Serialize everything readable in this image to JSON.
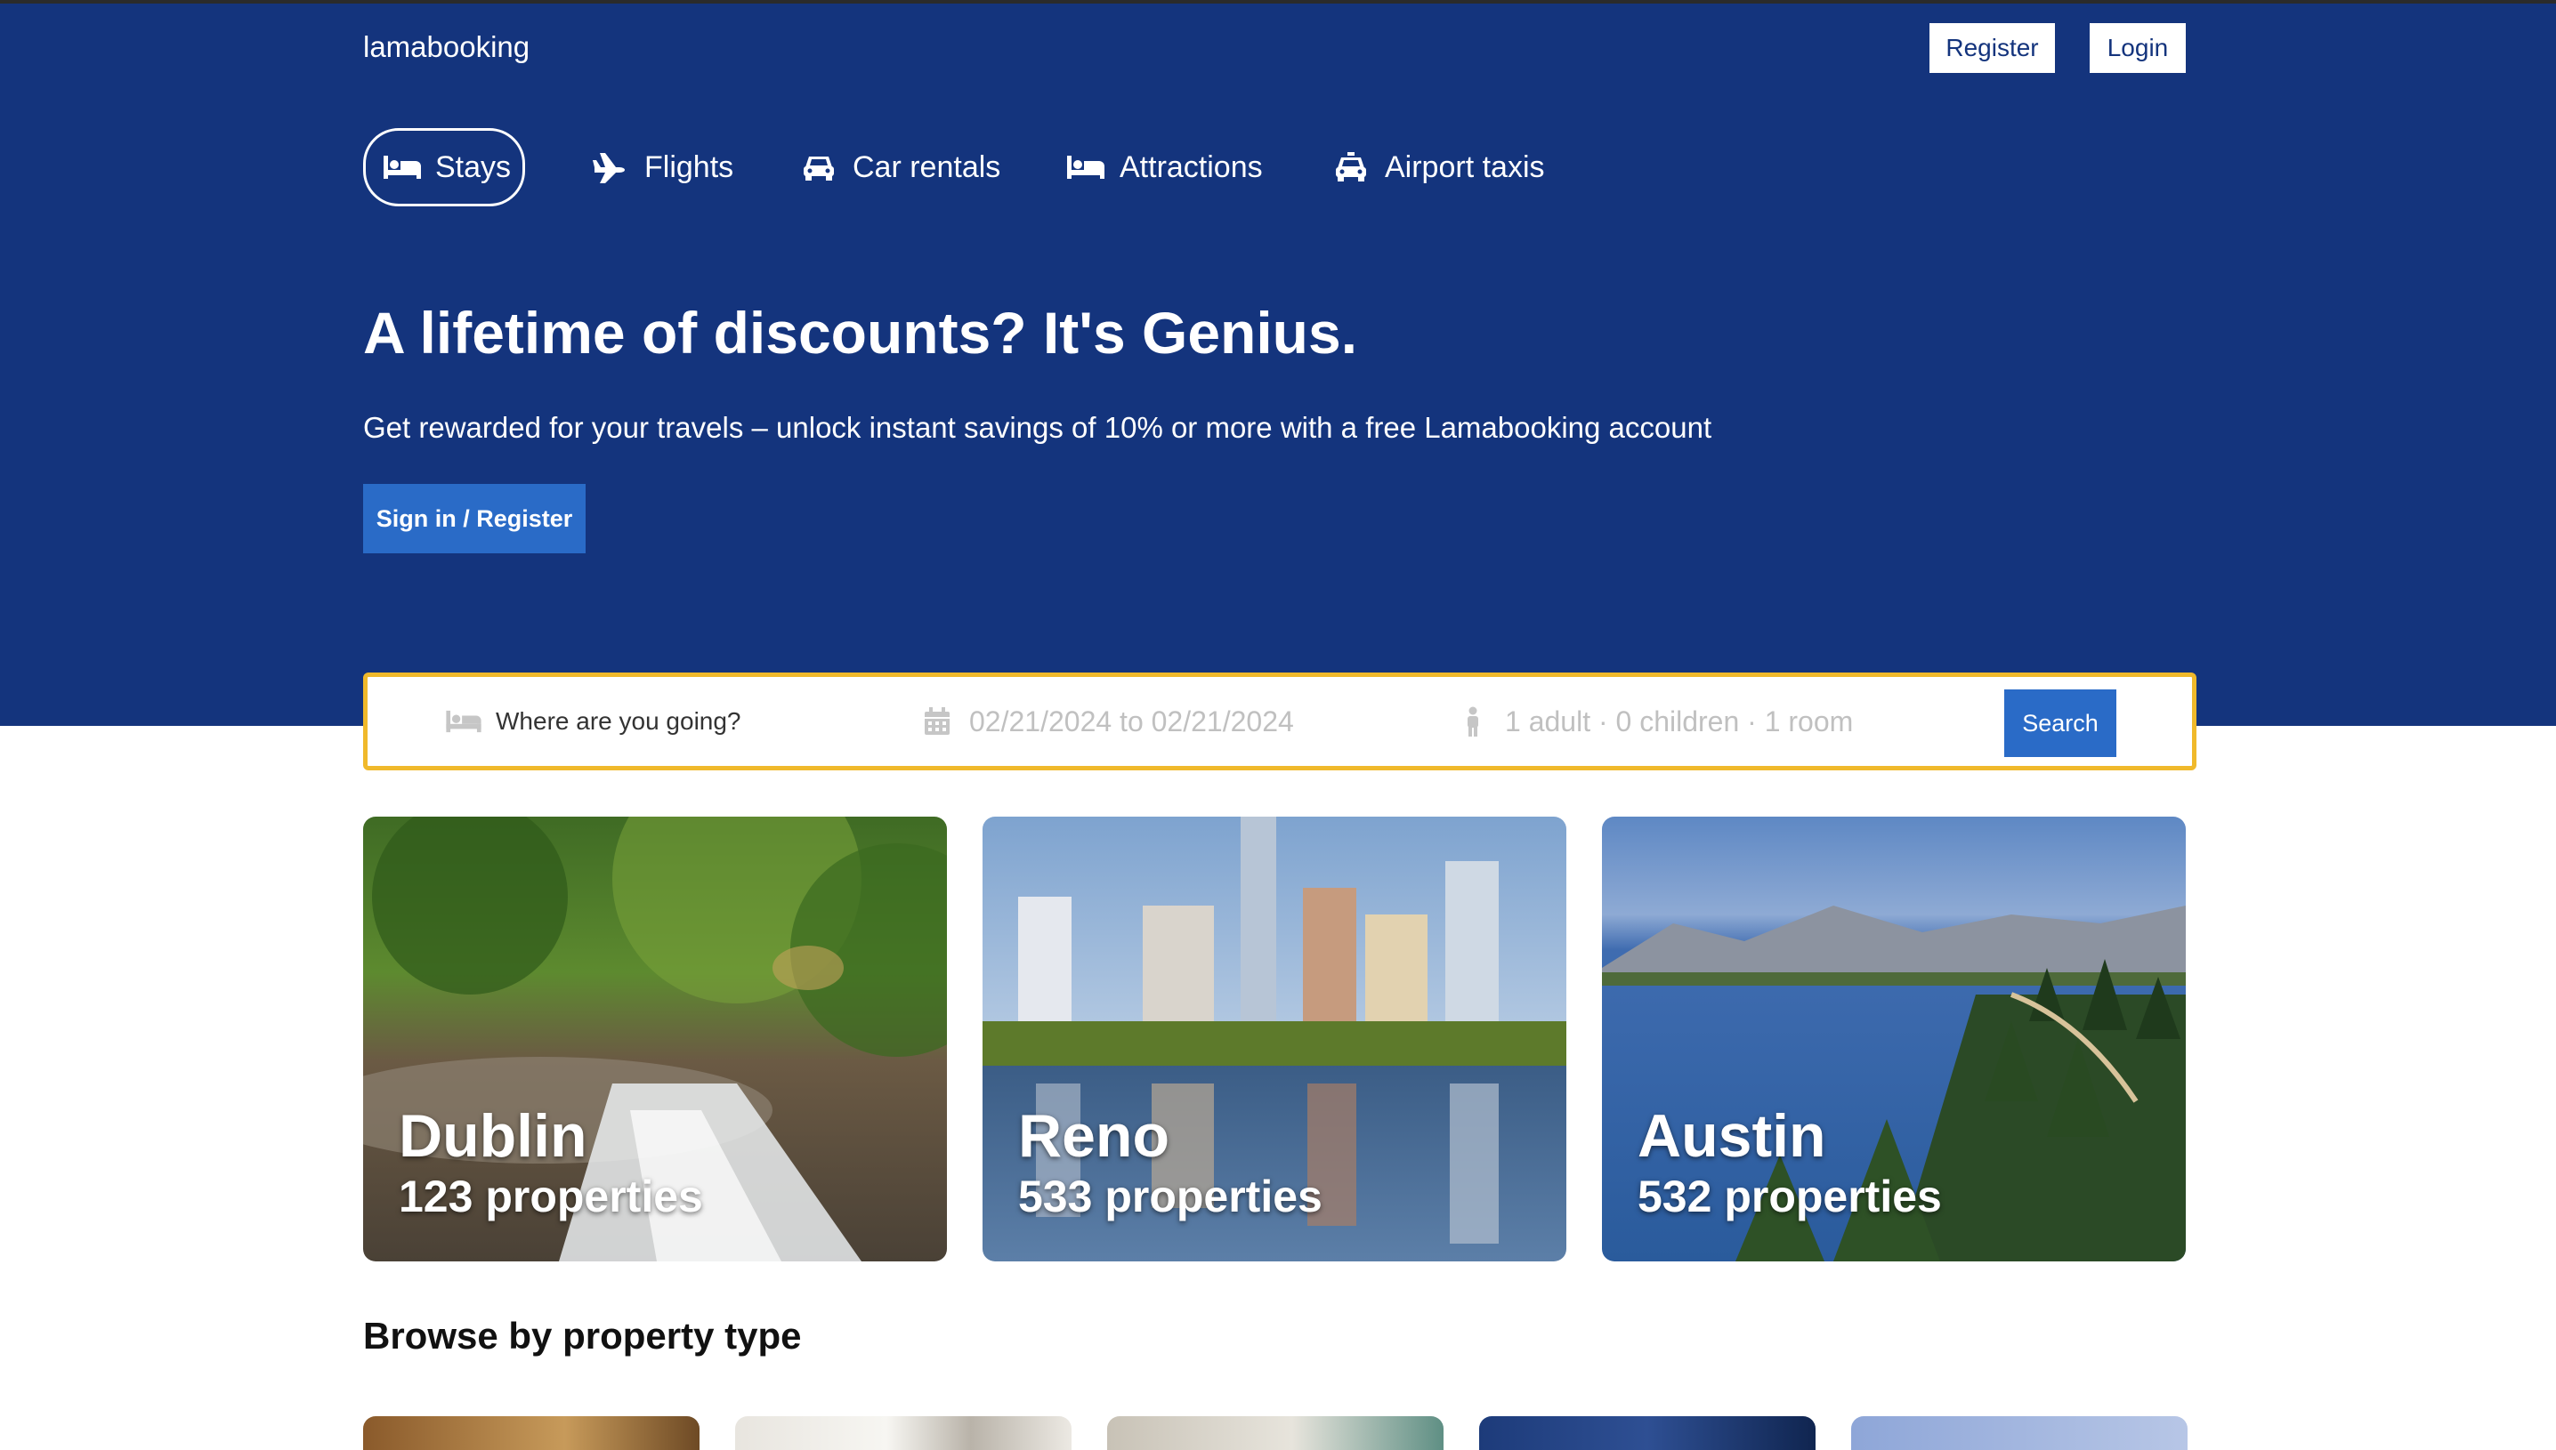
{
  "header": {
    "brand": "lamabooking",
    "register_label": "Register",
    "login_label": "Login"
  },
  "nav": {
    "items": [
      {
        "label": "Stays",
        "icon": "bed-icon",
        "active": true
      },
      {
        "label": "Flights",
        "icon": "plane-icon",
        "active": false
      },
      {
        "label": "Car rentals",
        "icon": "car-icon",
        "active": false
      },
      {
        "label": "Attractions",
        "icon": "bed-icon",
        "active": false
      },
      {
        "label": "Airport taxis",
        "icon": "taxi-icon",
        "active": false
      }
    ]
  },
  "hero": {
    "headline": "A lifetime of discounts? It's Genius.",
    "subline": "Get rewarded for your travels – unlock instant savings of 10% or more with a free Lamabooking account",
    "signin_label": "Sign in / Register"
  },
  "search": {
    "destination_placeholder": "Where are you going?",
    "dates": "02/21/2024 to 02/21/2024",
    "guests": "1 adult · 0 children · 1 room",
    "button_label": "Search"
  },
  "featured": [
    {
      "city": "Dublin",
      "properties": "123 properties",
      "image": "waterfall-forest"
    },
    {
      "city": "Reno",
      "properties": "533 properties",
      "image": "city-skyline-reflection"
    },
    {
      "city": "Austin",
      "properties": "532 properties",
      "image": "lake-mountains-forest"
    }
  ],
  "browse": {
    "title": "Browse by property type"
  },
  "colors": {
    "hero_bg": "#14347d",
    "accent_blue": "#2a6bc7",
    "search_border": "#f0b92b"
  }
}
